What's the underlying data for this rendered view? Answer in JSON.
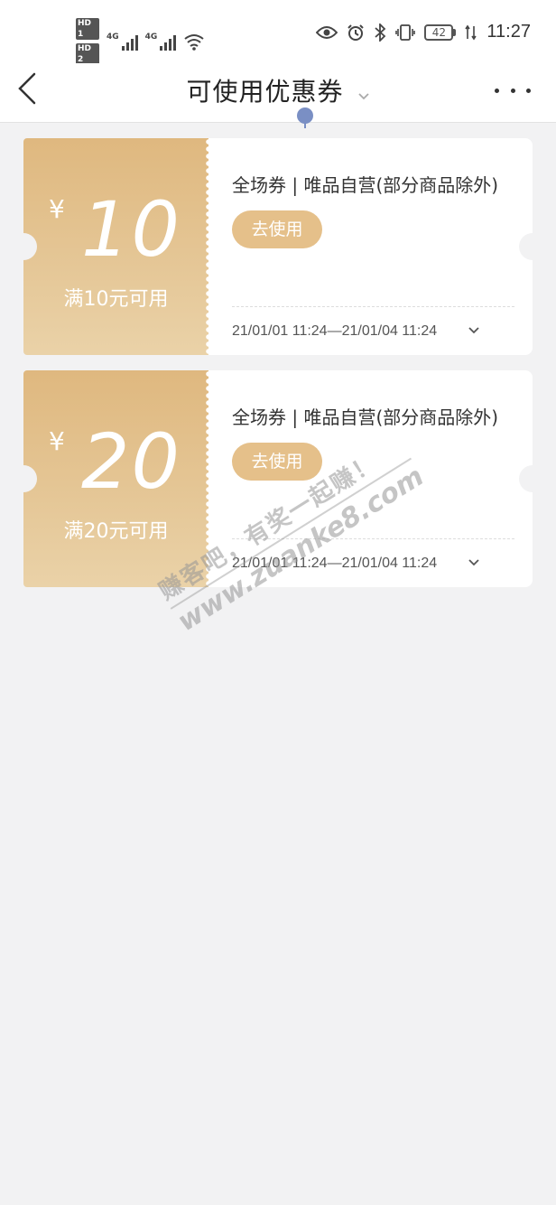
{
  "status_bar": {
    "hd1": "HD 1",
    "hd2": "HD 2",
    "signal1_label": "4G",
    "signal2_label": "4G",
    "battery": "42",
    "time": "11:27"
  },
  "header": {
    "title": "可使用优惠券"
  },
  "coupons": [
    {
      "currency": "¥",
      "amount": "10",
      "condition": "满10元可用",
      "description": "全场券 | 唯品自营(部分商品除外)",
      "action_label": "去使用",
      "validity": "21/01/01 11:24—21/01/04 11:24"
    },
    {
      "currency": "¥",
      "amount": "20",
      "condition": "满20元可用",
      "description": "全场券 | 唯品自营(部分商品除外)",
      "action_label": "去使用",
      "validity": "21/01/01 11:24—21/01/04 11:24"
    }
  ],
  "watermark": {
    "line1": "赚客吧，有奖一起赚！",
    "line2": "www.zuanke8.com"
  },
  "colors": {
    "accent_gold": "#e5c08a",
    "coupon_gradient_top": "#dfb87f",
    "coupon_gradient_bottom": "#ead2a8",
    "page_bg": "#f2f2f3",
    "indicator": "#7a8fc4"
  }
}
